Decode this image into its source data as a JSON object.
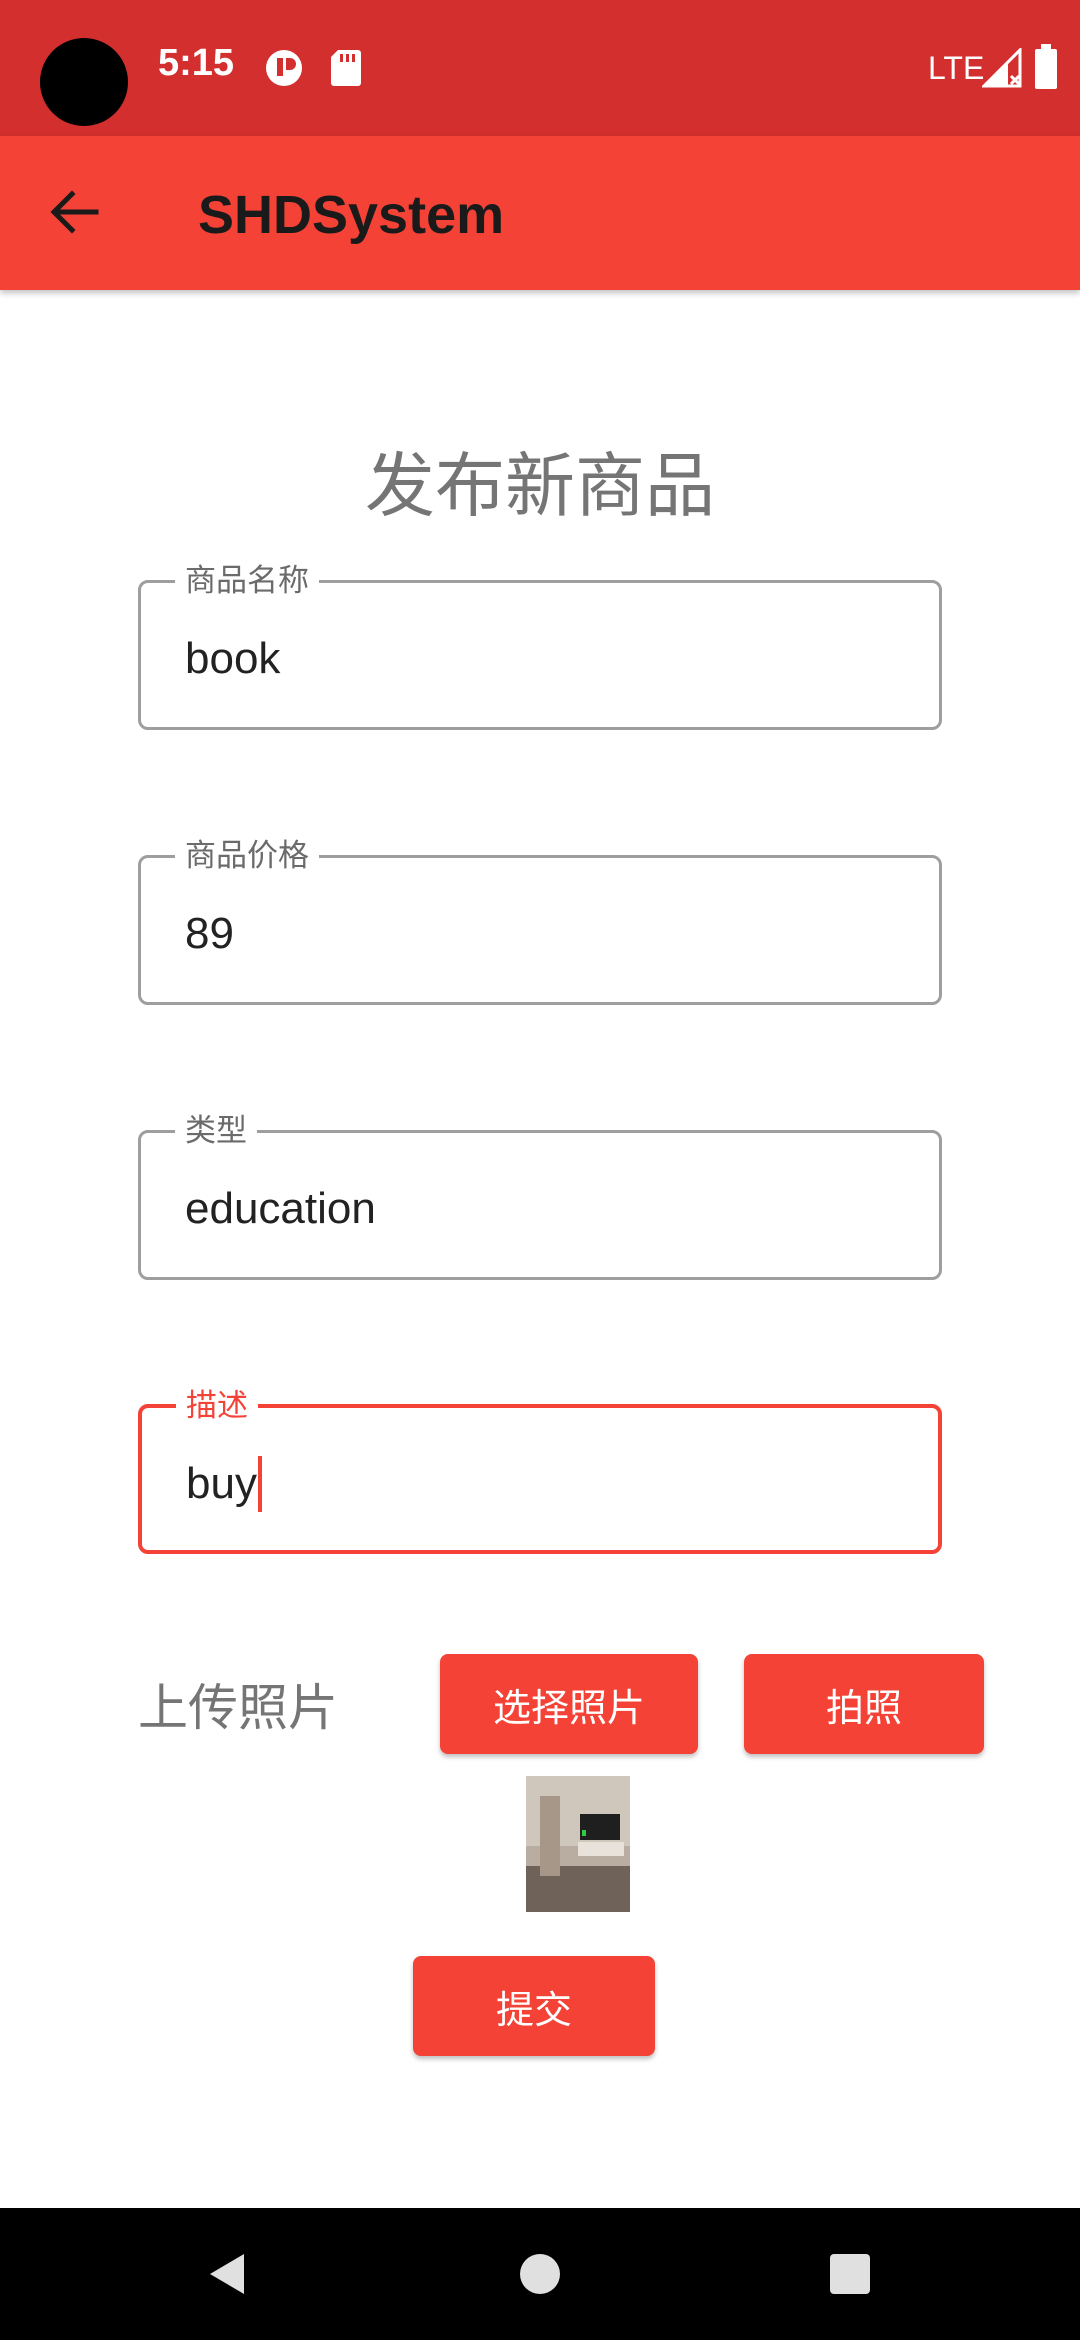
{
  "status_bar": {
    "time": "5:15",
    "network": "LTE",
    "icons": [
      "notification-icon",
      "sd-card-icon",
      "signal-icon",
      "battery-icon"
    ]
  },
  "app_bar": {
    "title": "SHDSystem",
    "back_icon": "arrow-back-icon"
  },
  "form": {
    "heading": "发布新商品",
    "fields": [
      {
        "label": "商品名称",
        "value": "book",
        "focused": false
      },
      {
        "label": "商品价格",
        "value": "89",
        "focused": false
      },
      {
        "label": "类型",
        "value": "education",
        "focused": false
      },
      {
        "label": "描述",
        "value": "buy",
        "focused": true
      }
    ],
    "upload": {
      "label": "上传照片",
      "choose_photo": "选择照片",
      "take_photo": "拍照"
    },
    "submit": "提交"
  },
  "colors": {
    "status_bar": "#d32f2f",
    "app_bar": "#f44336",
    "accent": "#f44336",
    "field_border": "#9e9e9e"
  },
  "nav_bar": {
    "icons": [
      "back-triangle-icon",
      "home-circle-icon",
      "recents-square-icon"
    ]
  }
}
